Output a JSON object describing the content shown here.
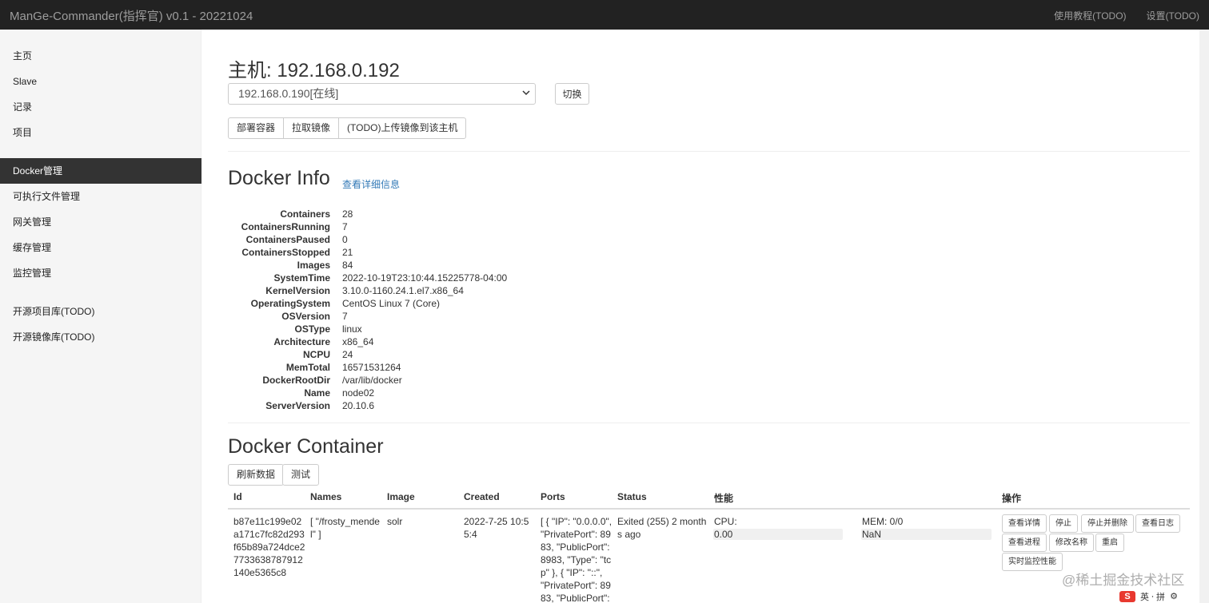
{
  "navbar": {
    "brand": "ManGe-Commander(指挥官) v0.1 - 20221024",
    "links": [
      "使用教程(TODO)",
      "设置(TODO)"
    ]
  },
  "sidebar": {
    "items": [
      "主页",
      "Slave",
      "记录",
      "项目",
      "Docker管理",
      "可执行文件管理",
      "网关管理",
      "缓存管理",
      "监控管理",
      "开源项目库(TODO)",
      "开源镜像库(TODO)"
    ],
    "active": "Docker管理"
  },
  "host": {
    "title": "主机: 192.168.0.192",
    "selected": "192.168.0.190[在线]",
    "switch_label": "切换",
    "actions": [
      "部署容器",
      "拉取镜像",
      "(TODO)上传镜像到该主机"
    ]
  },
  "docker_info": {
    "title": "Docker Info",
    "detail_link": "查看详细信息",
    "rows": [
      {
        "k": "Containers",
        "v": "28"
      },
      {
        "k": "ContainersRunning",
        "v": "7"
      },
      {
        "k": "ContainersPaused",
        "v": "0"
      },
      {
        "k": "ContainersStopped",
        "v": "21"
      },
      {
        "k": "Images",
        "v": "84"
      },
      {
        "k": "SystemTime",
        "v": "2022-10-19T23:10:44.15225778-04:00"
      },
      {
        "k": "KernelVersion",
        "v": "3.10.0-1160.24.1.el7.x86_64"
      },
      {
        "k": "OperatingSystem",
        "v": "CentOS Linux 7 (Core)"
      },
      {
        "k": "OSVersion",
        "v": "7"
      },
      {
        "k": "OSType",
        "v": "linux"
      },
      {
        "k": "Architecture",
        "v": "x86_64"
      },
      {
        "k": "NCPU",
        "v": "24"
      },
      {
        "k": "MemTotal",
        "v": "16571531264"
      },
      {
        "k": "DockerRootDir",
        "v": "/var/lib/docker"
      },
      {
        "k": "Name",
        "v": "node02"
      },
      {
        "k": "ServerVersion",
        "v": "20.10.6"
      }
    ]
  },
  "docker_container": {
    "title": "Docker Container",
    "buttons": [
      "刷新数据",
      "测试"
    ],
    "columns": [
      "Id",
      "Names",
      "Image",
      "Created",
      "Ports",
      "Status",
      "性能",
      "操作"
    ],
    "row": {
      "id_lines": [
        "b87e11c199e02",
        "a171c7fc82d293",
        "f65b89a724dce2",
        "7733638787912",
        "140e5365c8"
      ],
      "names_lines": [
        "[ \"/frosty_mende",
        "l\" ]"
      ],
      "image": "solr",
      "created_lines": [
        "2022-7-25 10:5",
        "5:4"
      ],
      "ports_lines": [
        "[ { \"IP\": \"0.0.0.0\",",
        "\"PrivatePort\": 89",
        "83, \"PublicPort\":",
        "8983, \"Type\": \"tc",
        "p\" }, { \"IP\": \"::\",",
        "\"PrivatePort\": 89",
        "83, \"PublicPort\":"
      ],
      "status_lines": [
        "Exited (255) 2 month",
        "s ago"
      ],
      "cpu_label": "CPU:",
      "cpu_value": "0.00",
      "cpu_fraction": 0,
      "mem_label": "MEM: 0/0",
      "mem_value": "NaN",
      "mem_fraction": 0,
      "actions": [
        "查看详情",
        "停止",
        "停止并删除",
        "查看日志",
        "查看进程",
        "修改名称",
        "重启",
        "实时监控性能"
      ]
    }
  },
  "overlay": {
    "watermark": "@稀土掘金技术社区",
    "ime_logo": "S",
    "ime_text": "英 ⸱ 拼"
  }
}
